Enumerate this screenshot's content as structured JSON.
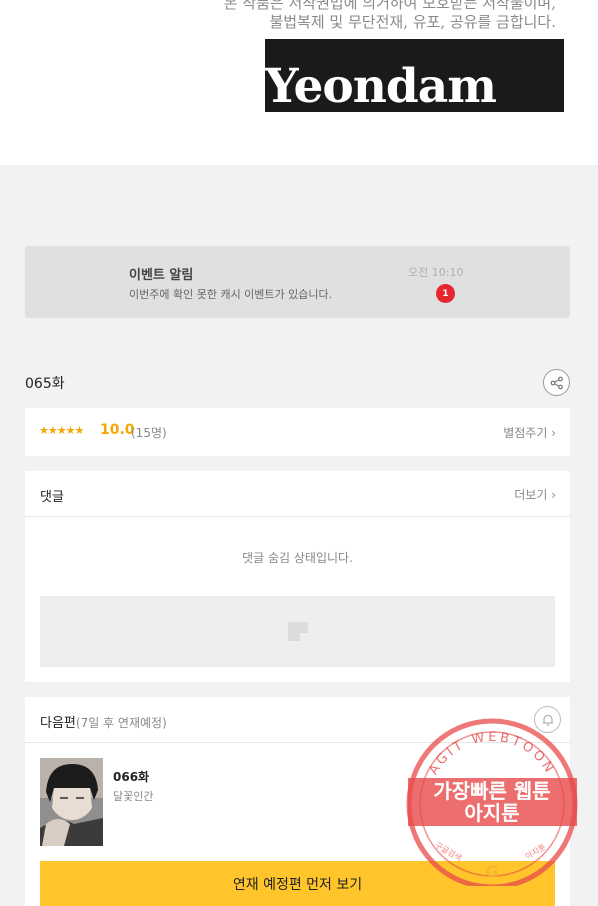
{
  "header": {
    "copyright_line1": "본 작품은 저작권법에 의거하여 보호받는 저작물이며,",
    "copyright_line2": "불법복제 및 무단전재, 유포, 공유를 금합니다.",
    "logo_text": "Yeondam"
  },
  "notification": {
    "title": "이벤트 알림",
    "message": "이번주에 확인 못한 캐시 이벤트가 있습니다.",
    "time": "오전 10:10",
    "badge_count": "1"
  },
  "episode": {
    "title": "065화",
    "share_icon": "share-icon"
  },
  "rating": {
    "stars": "★★★★★",
    "score": "10.0",
    "count": "(15명)",
    "rate_link": "별점주기 ›"
  },
  "comments": {
    "title": "댓글",
    "more_link": "더보기 ›",
    "hidden_message": "댓글 숨김 상태입니다."
  },
  "next_episode": {
    "title": "다음편",
    "subtitle": "(7일 후 연재예정)",
    "episode": "066화",
    "series_name": "달꽃인간",
    "cta_label": "연재 예정편 먼저 보기",
    "bell_icon": "bell-icon"
  },
  "watermark": {
    "arc_text": "AGIT WEBTOON",
    "line1": "가장빠른 웹툰",
    "line2": "아지툰",
    "small_left": "구글검색",
    "small_right": "아지툰",
    "g_letter": "G"
  },
  "colors": {
    "accent": "#ffc52a",
    "star": "#f5a600",
    "badge": "#e6262e",
    "watermark": "#e84a4a"
  }
}
